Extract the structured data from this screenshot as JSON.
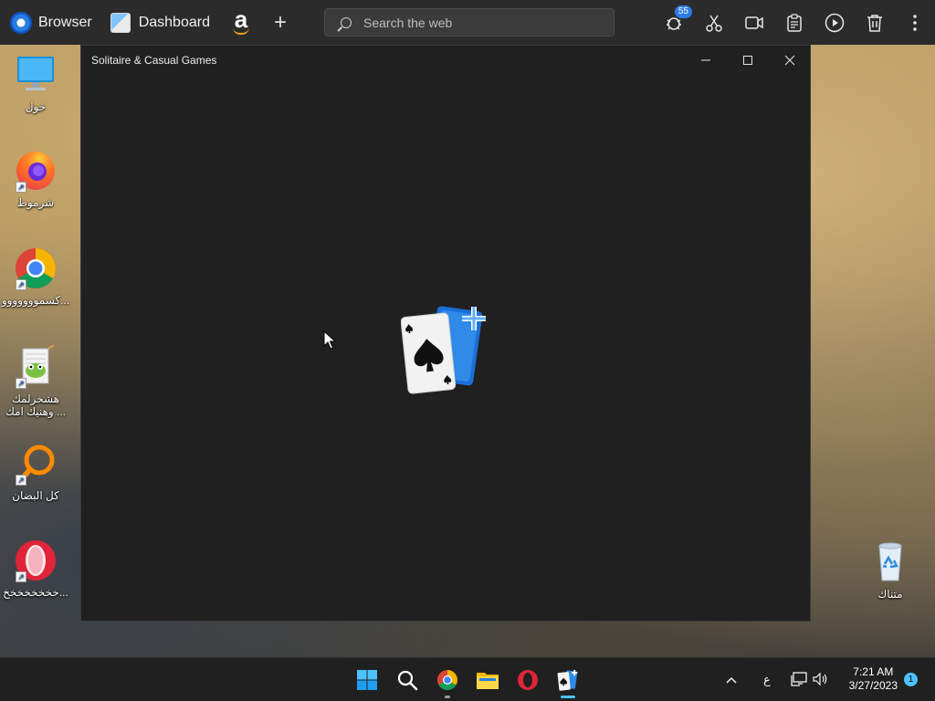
{
  "browser_bar": {
    "browser_label": "Browser",
    "dashboard_label": "Dashboard",
    "search_placeholder": "Search the web",
    "notification_count": "55"
  },
  "desktop_icons": [
    {
      "label": "خول"
    },
    {
      "label": "شرموط"
    },
    {
      "label": "كسمووووووو..."
    },
    {
      "label": "هشخرلمك وهنيك امك ..."
    },
    {
      "label": "كل البضان"
    },
    {
      "label": "خخخخخخخخ..."
    },
    {
      "label": "متناك"
    }
  ],
  "window": {
    "title": "Solitaire & Casual Games"
  },
  "taskbar": {
    "language": "ع",
    "time": "7:21 AM",
    "date": "3/27/2023",
    "notification_count": "1"
  },
  "colors": {
    "topbar_bg": "#2b2b2b",
    "window_bg": "#202020",
    "taskbar_bg": "#202020",
    "accent": "#4cc2ff"
  }
}
